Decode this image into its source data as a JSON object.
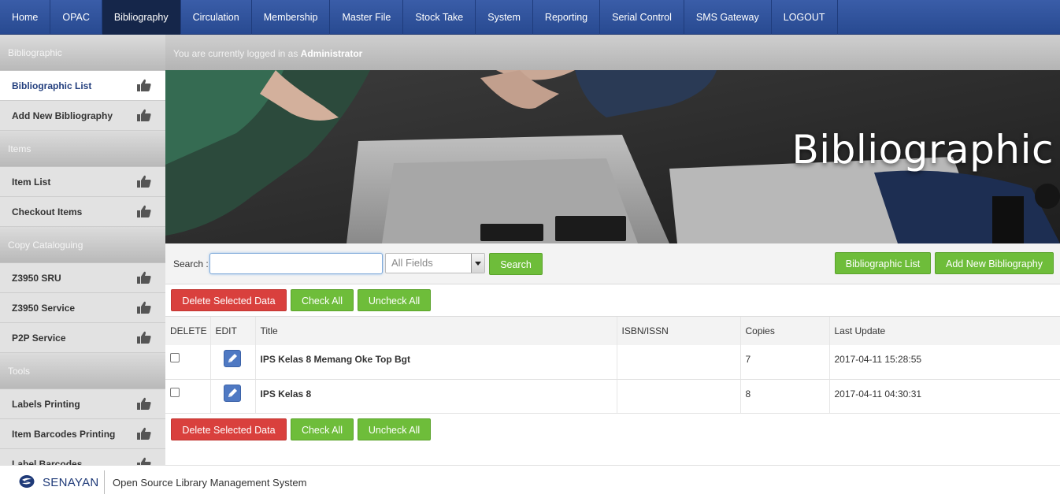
{
  "nav": {
    "items": [
      "Home",
      "OPAC",
      "Bibliography",
      "Circulation",
      "Membership",
      "Master File",
      "Stock Take",
      "System",
      "Reporting",
      "Serial Control",
      "SMS Gateway",
      "LOGOUT"
    ],
    "active": "Bibliography"
  },
  "sidebar": {
    "sections": [
      {
        "header": "Bibliographic",
        "items": [
          "Bibliographic List",
          "Add New Bibliography"
        ]
      },
      {
        "header": "Items",
        "items": [
          "Item List",
          "Checkout Items"
        ]
      },
      {
        "header": "Copy Cataloguing",
        "items": [
          "Z3950 SRU",
          "Z3950 Service",
          "P2P Service"
        ]
      },
      {
        "header": "Tools",
        "items": [
          "Labels Printing",
          "Item Barcodes Printing",
          "Label Barcodes"
        ]
      }
    ],
    "active_item": "Bibliographic List",
    "item_icon": "thumbs-up-icon"
  },
  "login": {
    "prefix": "You are currently logged in as ",
    "user": "Administrator"
  },
  "banner": {
    "heading": "Bibliographic"
  },
  "search": {
    "label": "Search :",
    "value": "",
    "field_selected": "All Fields",
    "button": "Search",
    "right_buttons": [
      "Bibliographic List",
      "Add New Bibliography"
    ]
  },
  "actions": {
    "delete": "Delete Selected Data",
    "check_all": "Check All",
    "uncheck_all": "Uncheck All"
  },
  "table": {
    "columns": [
      "DELETE",
      "EDIT",
      "Title",
      "ISBN/ISSN",
      "Copies",
      "Last Update"
    ],
    "rows": [
      {
        "title": "IPS Kelas 8 Memang Oke Top Bgt",
        "isbn": "",
        "copies": "7",
        "last_update": "2017-04-11 15:28:55"
      },
      {
        "title": "IPS Kelas 8",
        "isbn": "",
        "copies": "8",
        "last_update": "2017-04-11 04:30:31"
      }
    ]
  },
  "footer": {
    "brand": "SENAYAN",
    "tagline": "Open Source Library Management System"
  },
  "colors": {
    "nav": "#2f529c",
    "green": "#6ebd3a",
    "red": "#d9403d",
    "edit": "#4f79c3"
  }
}
